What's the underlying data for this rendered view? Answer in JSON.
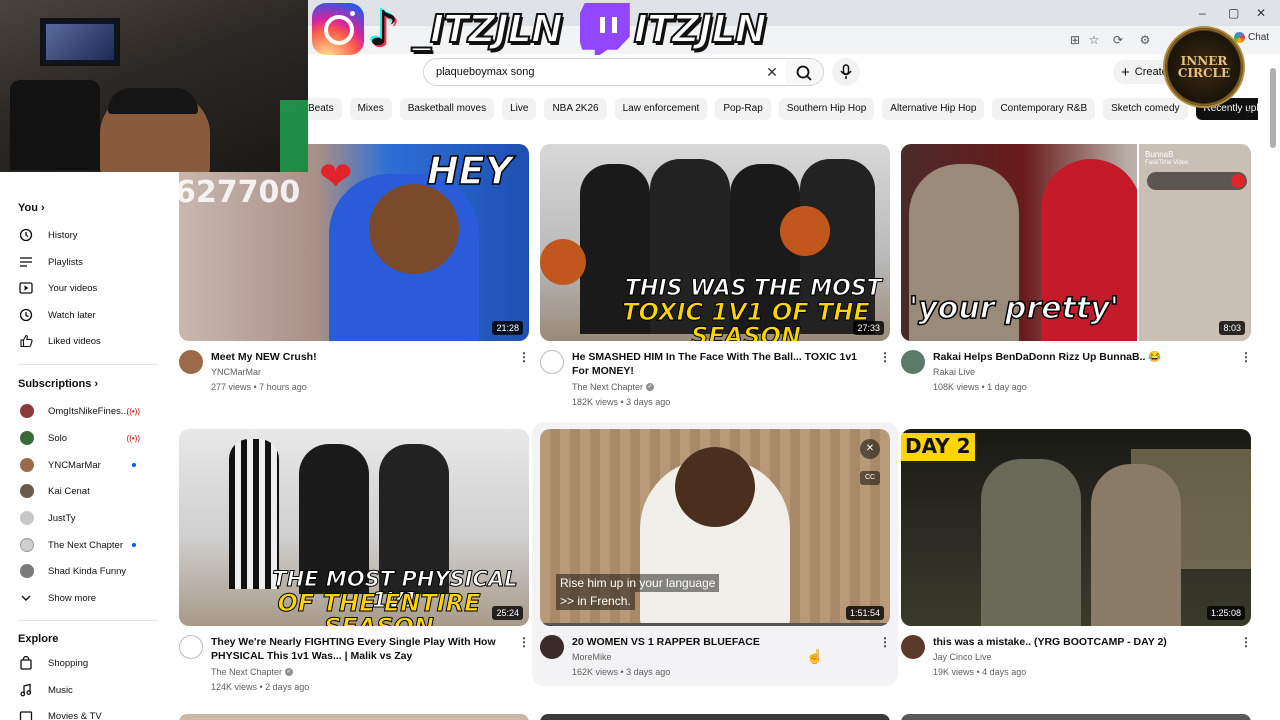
{
  "overlay": {
    "social_handle_1": "_ITZJLN",
    "social_handle_2": "ITZJLN",
    "badge_line1": "INNER",
    "badge_line2": "CIRCLE"
  },
  "browser": {
    "chat_label": "Chat",
    "window_controls": [
      "–",
      "▢",
      "✕"
    ]
  },
  "search": {
    "query": "plaqueboymax song",
    "create_label": "Create"
  },
  "chips": [
    "Beats",
    "Mixes",
    "Basketball moves",
    "Live",
    "NBA 2K26",
    "Law enforcement",
    "Pop-Rap",
    "Southern Hip Hop",
    "Alternative Hip Hop",
    "Contemporary R&B",
    "Sketch comedy",
    "Recently uploaded"
  ],
  "sidebar": {
    "you_label": "You",
    "you_items": [
      {
        "label": "History",
        "icon": "history-icon"
      },
      {
        "label": "Playlists",
        "icon": "playlists-icon"
      },
      {
        "label": "Your videos",
        "icon": "your-videos-icon"
      },
      {
        "label": "Watch later",
        "icon": "watch-later-icon"
      },
      {
        "label": "Liked videos",
        "icon": "liked-videos-icon"
      }
    ],
    "subscriptions_label": "Subscriptions",
    "subscriptions": [
      {
        "label": "OmgItsNikeFines...",
        "status": "live",
        "color": "#8a3a3a"
      },
      {
        "label": "Solo",
        "status": "live",
        "color": "#3a6a3a"
      },
      {
        "label": "YNCMarMar",
        "status": "new",
        "color": "#9a6a4a"
      },
      {
        "label": "Kai Cenat",
        "status": "none",
        "color": "#6a5a4a"
      },
      {
        "label": "JustTy",
        "status": "none",
        "color": "#c8c8c8"
      },
      {
        "label": "The Next Chapter",
        "status": "new",
        "color": "#d0d0d0"
      },
      {
        "label": "Shad Kinda Funny",
        "status": "none",
        "color": "#7a7a7a"
      }
    ],
    "show_more_label": "Show more",
    "explore_label": "Explore",
    "explore_items": [
      {
        "label": "Shopping",
        "icon": "shopping-icon"
      },
      {
        "label": "Music",
        "icon": "music-icon"
      },
      {
        "label": "Movies & TV",
        "icon": "movies-icon"
      }
    ]
  },
  "videos": [
    {
      "title": "Meet My NEW Crush!",
      "channel": "YNCMarMar",
      "verified": false,
      "stats": "277 views • 7 hours ago",
      "duration": "21:28",
      "thumb_text": "HEY",
      "thumb_number": "627700"
    },
    {
      "title": "He SMASHED HIM In The Face With The Ball... TOXIC 1v1 For MONEY!",
      "channel": "The Next Chapter",
      "verified": true,
      "stats": "182K views • 3 days ago",
      "duration": "27:33",
      "thumb_text_1": "THIS WAS THE MOST",
      "thumb_text_2": "TOXIC 1V1 OF THE SEASON"
    },
    {
      "title": "Rakai Helps BenDaDonn Rizz Up BunnaB.. 😂",
      "channel": "Rakai Live",
      "verified": false,
      "stats": "108K views • 1 day ago",
      "duration": "8:03",
      "thumb_text": "'your pretty'",
      "facetime_name": "BunnaB",
      "facetime_sub": "FaceTime Video"
    },
    {
      "title": "They We're Nearly FIGHTING Every Single Play With How PHYSICAL This 1v1 Was... | Malik vs Zay",
      "channel": "The Next Chapter",
      "verified": true,
      "stats": "124K views • 2 days ago",
      "duration": "25:24",
      "thumb_text_1": "THE MOST PHYSICAL 1V1",
      "thumb_text_2": "OF THE ENTIRE SEASON"
    },
    {
      "title": "20 WOMEN VS 1 RAPPER BLUEFACE",
      "channel": "MoreMike",
      "verified": false,
      "stats": "162K views • 3 days ago",
      "duration": "1:51:54",
      "caption_1": "Rise him up in your language",
      "caption_2": ">> in French."
    },
    {
      "title": "this was a mistake.. (YRG BOOTCAMP - DAY 2)",
      "channel": "Jay Cinco Live",
      "verified": false,
      "stats": "19K views • 4 days ago",
      "duration": "1:25:08",
      "thumb_text": "DAY 2"
    }
  ]
}
